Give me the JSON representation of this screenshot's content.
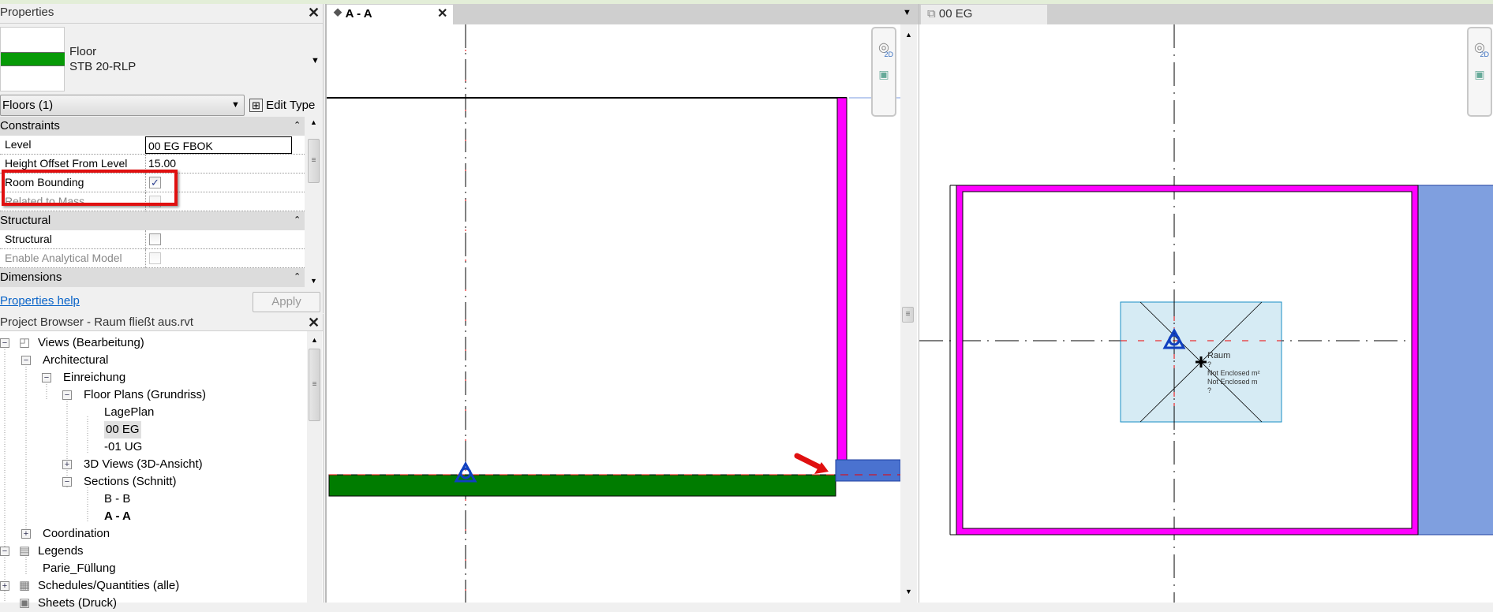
{
  "properties": {
    "title": "Properties",
    "type_family": "Floor",
    "type_name": "STB 20-RLP",
    "instance_selector": "Floors (1)",
    "edit_type_label": "Edit Type",
    "groups": [
      {
        "name": "Constraints",
        "rows": [
          {
            "label": "Level",
            "value": "00 EG FBOK"
          },
          {
            "label": "Height Offset From Level",
            "value": "15.00"
          },
          {
            "label": "Room Bounding",
            "checked": true
          },
          {
            "label": "Related to Mass",
            "checked": false
          }
        ]
      },
      {
        "name": "Structural",
        "rows": [
          {
            "label": "Structural",
            "checked": false
          },
          {
            "label": "Enable Analytical Model",
            "checked": false
          }
        ]
      },
      {
        "name": "Dimensions"
      }
    ],
    "help_link": "Properties help",
    "apply_label": "Apply",
    "check_glyph": "✓"
  },
  "project_browser": {
    "title": "Project Browser - Raum fließt aus.rvt",
    "items": [
      "Views (Bearbeitung)",
      "Architectural",
      "Einreichung",
      "Floor Plans (Grundriss)",
      "LagePlan",
      "00 EG",
      "-01 UG",
      "3D Views (3D-Ansicht)",
      "Sections (Schnitt)",
      "B - B",
      "A - A",
      "Coordination",
      "Legends",
      "Parie_Füllung",
      "Schedules/Quantities (alle)",
      "Sheets (Druck)"
    ]
  },
  "views": {
    "section_tab": "A - A",
    "plan_tab": "00 EG",
    "nav_2d_label": "2D",
    "room_tag": {
      "name": "Raum",
      "number": "?",
      "area": "Not Enclosed m²",
      "perimeter": "Not Enclosed m",
      "extra": "?"
    }
  },
  "colors": {
    "wall": "#ff00ff",
    "floor_section": "#007c00",
    "slab": "#4a72d0",
    "room": "#d6ebf4",
    "annotation_arrow": "#e01010"
  }
}
